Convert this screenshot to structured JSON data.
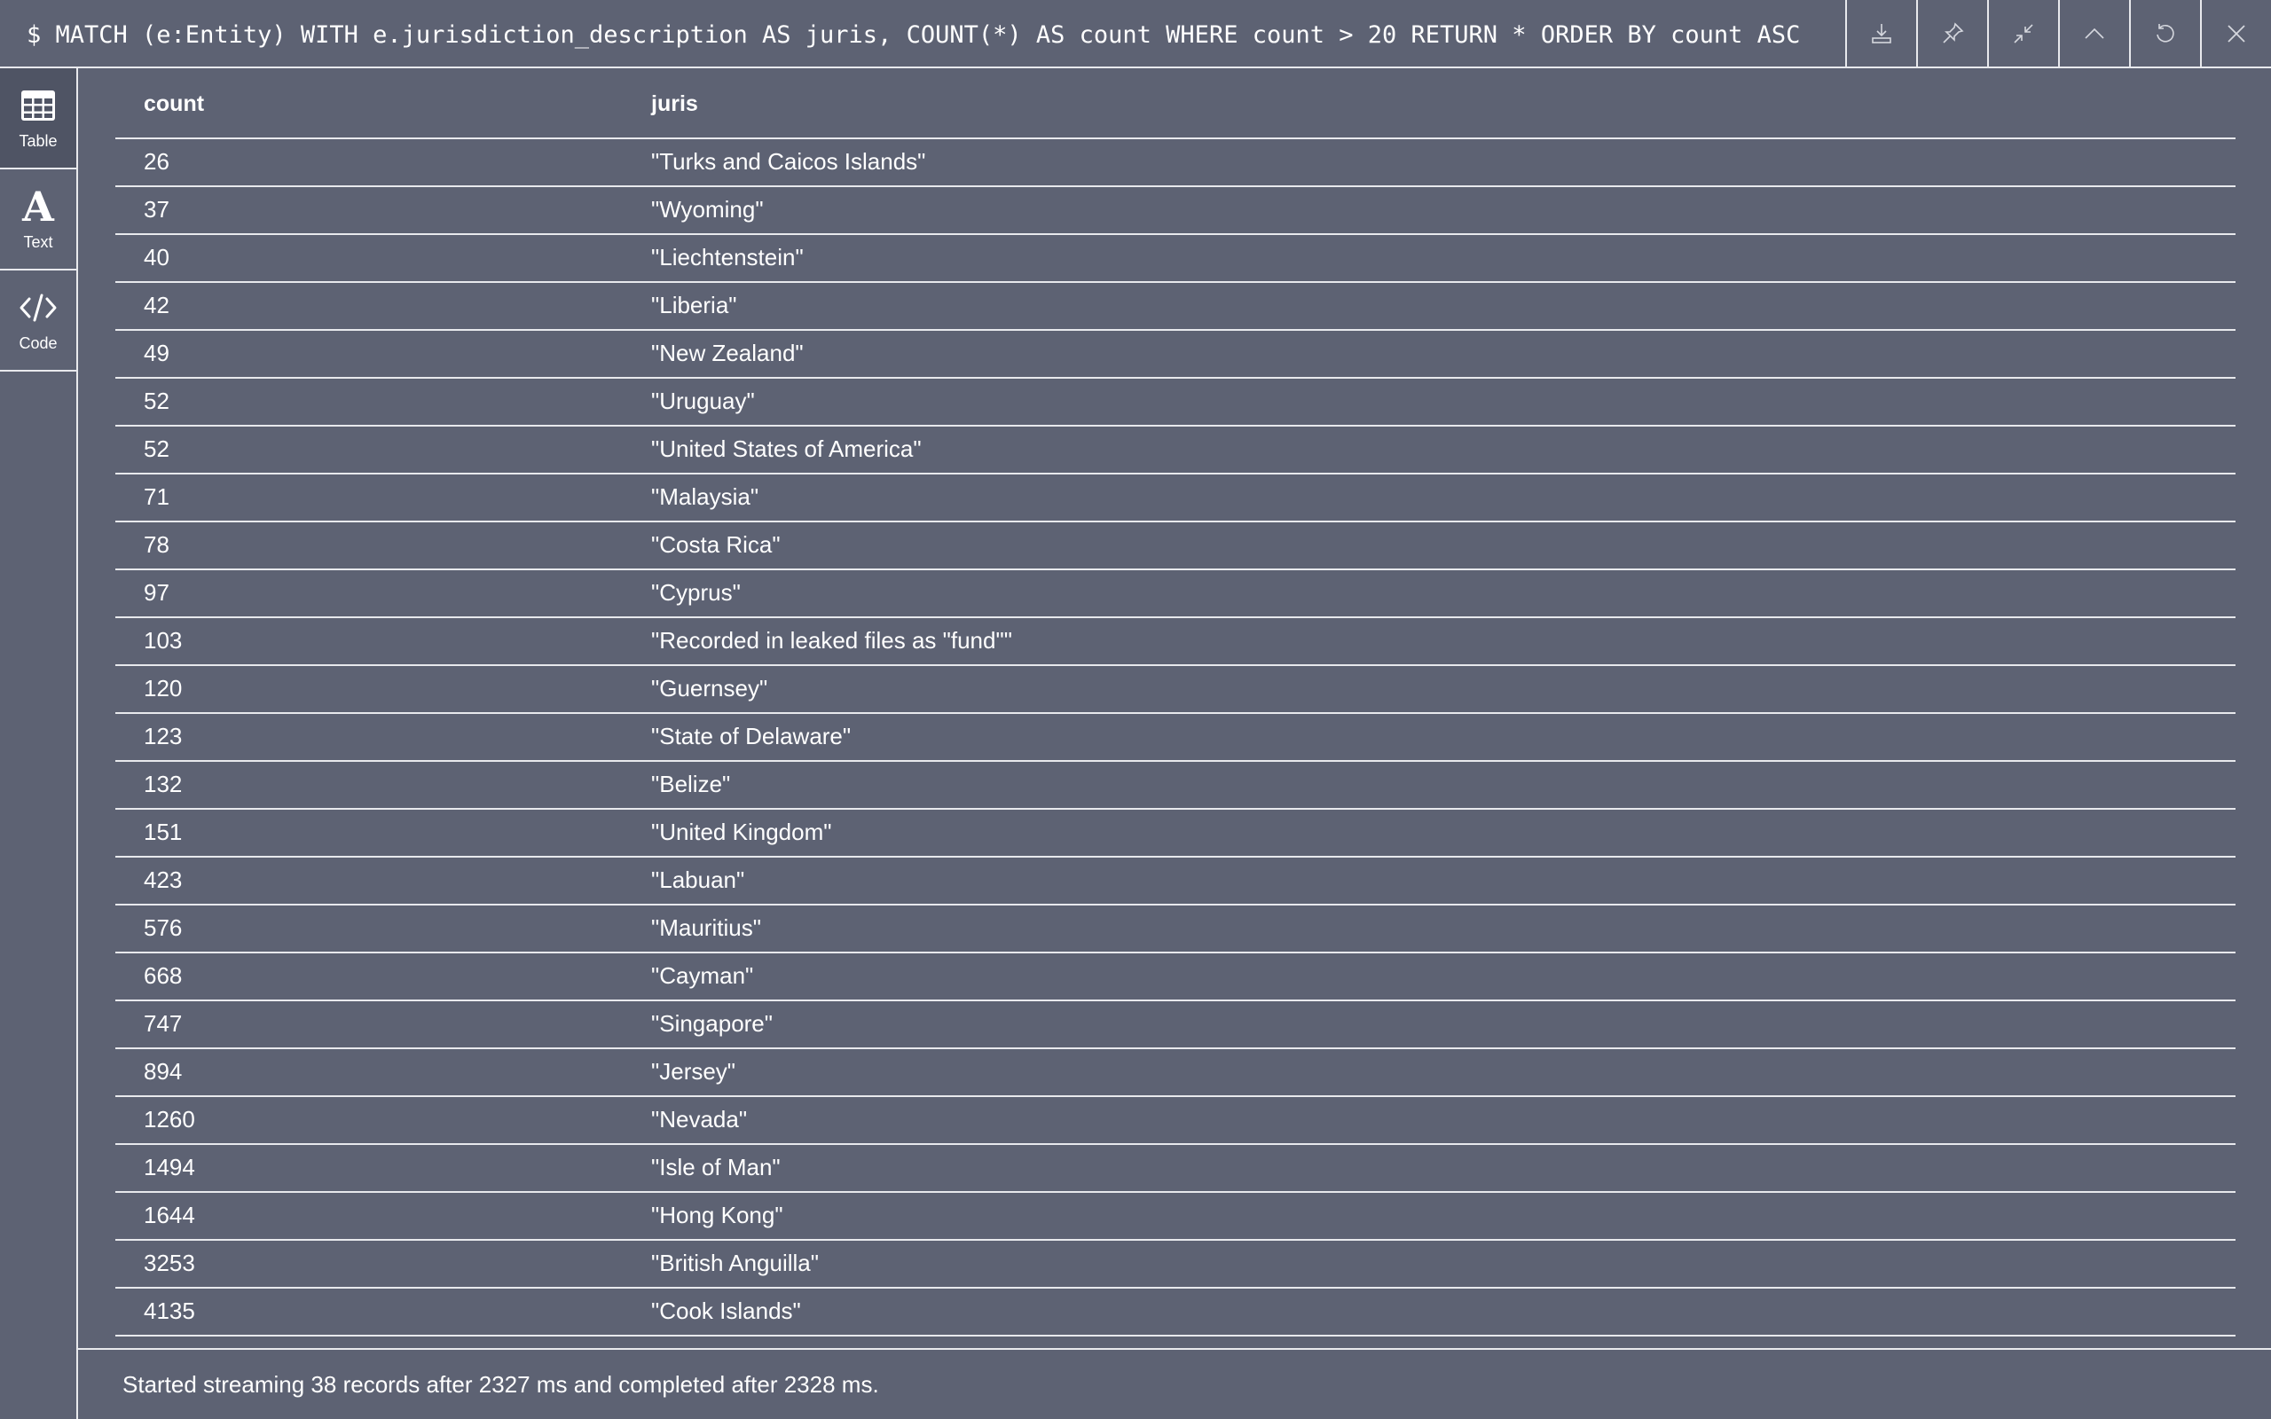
{
  "query": "$ MATCH (e:Entity) WITH e.jurisdiction_description AS juris, COUNT(*) AS count WHERE count > 20 RETURN * ORDER BY count ASC",
  "toolbar": [
    "download-icon",
    "pin-icon",
    "collapse-icon",
    "chevron-up-icon",
    "refresh-icon",
    "close-icon"
  ],
  "sidebar": {
    "table_label": "Table",
    "text_label": "Text",
    "code_label": "Code"
  },
  "table": {
    "headers": [
      "count",
      "juris"
    ],
    "rows": [
      [
        "26",
        "\"Turks and Caicos Islands\""
      ],
      [
        "37",
        "\"Wyoming\""
      ],
      [
        "40",
        "\"Liechtenstein\""
      ],
      [
        "42",
        "\"Liberia\""
      ],
      [
        "49",
        "\"New Zealand\""
      ],
      [
        "52",
        "\"Uruguay\""
      ],
      [
        "52",
        "\"United States of America\""
      ],
      [
        "71",
        "\"Malaysia\""
      ],
      [
        "78",
        "\"Costa Rica\""
      ],
      [
        "97",
        "\"Cyprus\""
      ],
      [
        "103",
        "\"Recorded in leaked files as \"fund\"\""
      ],
      [
        "120",
        "\"Guernsey\""
      ],
      [
        "123",
        "\"State of Delaware\""
      ],
      [
        "132",
        "\"Belize\""
      ],
      [
        "151",
        "\"United Kingdom\""
      ],
      [
        "423",
        "\"Labuan\""
      ],
      [
        "576",
        "\"Mauritius\""
      ],
      [
        "668",
        "\"Cayman\""
      ],
      [
        "747",
        "\"Singapore\""
      ],
      [
        "894",
        "\"Jersey\""
      ],
      [
        "1260",
        "\"Nevada\""
      ],
      [
        "1494",
        "\"Isle of Man\""
      ],
      [
        "1644",
        "\"Hong Kong\""
      ],
      [
        "3253",
        "\"British Anguilla\""
      ],
      [
        "4135",
        "\"Cook Islands\""
      ]
    ]
  },
  "status": "Started streaming 38 records after 2327 ms and completed after 2328 ms.",
  "colors": {
    "background": "#5d6273",
    "divider": "#e8e9ed",
    "active_tab": "#4f5464"
  }
}
